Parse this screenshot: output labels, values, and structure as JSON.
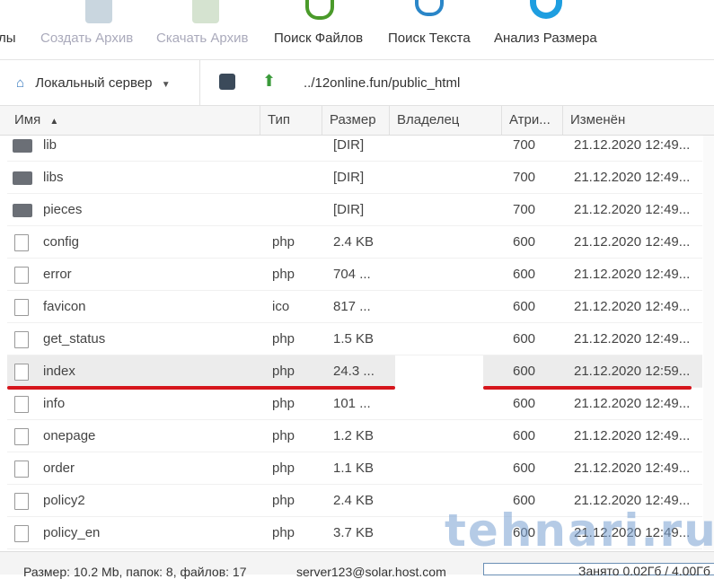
{
  "toolbar": {
    "items": [
      {
        "label": "лы",
        "disabled": false
      },
      {
        "label": "Создать Архив",
        "disabled": true
      },
      {
        "label": "Скачать Архив",
        "disabled": true
      },
      {
        "label": "Поиск Файлов",
        "disabled": false
      },
      {
        "label": "Поиск Текста",
        "disabled": false
      },
      {
        "label": "Анализ Размера",
        "disabled": false
      }
    ]
  },
  "address": {
    "server": "Локальный сервер",
    "path": "../12online.fun/public_html"
  },
  "columns": {
    "name": "Имя",
    "type": "Тип",
    "size": "Размер",
    "owner": "Владелец",
    "attr": "Атри...",
    "modified": "Изменён"
  },
  "files": [
    {
      "name": "lib",
      "type": "",
      "size": "[DIR]",
      "attr": "700",
      "modified": "21.12.2020 12:49...",
      "kind": "folder"
    },
    {
      "name": "libs",
      "type": "",
      "size": "[DIR]",
      "attr": "700",
      "modified": "21.12.2020 12:49...",
      "kind": "folder"
    },
    {
      "name": "pieces",
      "type": "",
      "size": "[DIR]",
      "attr": "700",
      "modified": "21.12.2020 12:49...",
      "kind": "folder"
    },
    {
      "name": "config",
      "type": "php",
      "size": "2.4 KB",
      "attr": "600",
      "modified": "21.12.2020 12:49...",
      "kind": "file"
    },
    {
      "name": "error",
      "type": "php",
      "size": "704 ...",
      "attr": "600",
      "modified": "21.12.2020 12:49...",
      "kind": "file"
    },
    {
      "name": "favicon",
      "type": "ico",
      "size": "817 ...",
      "attr": "600",
      "modified": "21.12.2020 12:49...",
      "kind": "file"
    },
    {
      "name": "get_status",
      "type": "php",
      "size": "1.5 KB",
      "attr": "600",
      "modified": "21.12.2020 12:49...",
      "kind": "file"
    },
    {
      "name": "index",
      "type": "php",
      "size": "24.3 ...",
      "attr": "600",
      "modified": "21.12.2020 12:59...",
      "kind": "file",
      "selected": true
    },
    {
      "name": "info",
      "type": "php",
      "size": "101 ...",
      "attr": "600",
      "modified": "21.12.2020 12:49...",
      "kind": "file"
    },
    {
      "name": "onepage",
      "type": "php",
      "size": "1.2 KB",
      "attr": "600",
      "modified": "21.12.2020 12:49...",
      "kind": "file"
    },
    {
      "name": "order",
      "type": "php",
      "size": "1.1 KB",
      "attr": "600",
      "modified": "21.12.2020 12:49...",
      "kind": "file"
    },
    {
      "name": "policy2",
      "type": "php",
      "size": "2.4 KB",
      "attr": "600",
      "modified": "21.12.2020 12:49...",
      "kind": "file"
    },
    {
      "name": "policy_en",
      "type": "php",
      "size": "3.7 KB",
      "attr": "600",
      "modified": "21.12.2020 12:49...",
      "kind": "file"
    }
  ],
  "status": {
    "summary": "Размер: 10.2 Mb, папок: 8, файлов: 17",
    "account": "server123@solar.host.com",
    "quota": "Занято 0.02Гб / 4.00Гб"
  },
  "watermark": "tehnari.ru"
}
